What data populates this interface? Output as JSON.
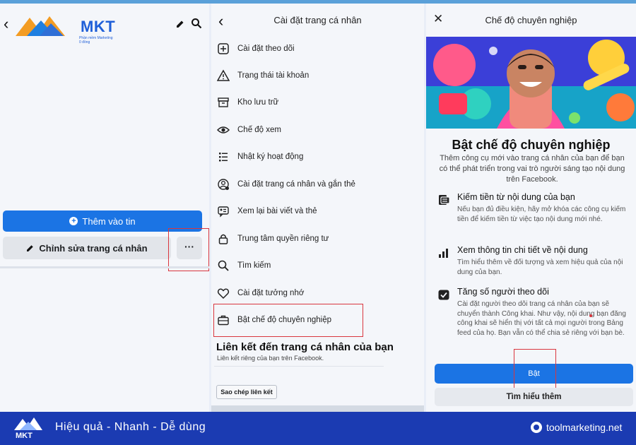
{
  "panel_left": {
    "logo": {
      "text": "MKT",
      "tagline": "Phần mềm Marketing 0 đồng"
    },
    "add_story_button": "Thêm vào tin",
    "edit_profile_button": "Chỉnh sửa trang cá nhân",
    "more_button": "···"
  },
  "panel_middle": {
    "title": "Cài đặt trang cá nhân",
    "menu": [
      {
        "label": "Cài đặt theo dõi",
        "icon": "follow-settings-icon"
      },
      {
        "label": "Trạng thái tài khoản",
        "icon": "warning-icon"
      },
      {
        "label": "Kho lưu trữ",
        "icon": "archive-icon"
      },
      {
        "label": "Chế độ xem",
        "icon": "eye-icon"
      },
      {
        "label": "Nhật ký hoạt động",
        "icon": "activity-log-icon"
      },
      {
        "label": "Cài đặt trang cá nhân và gắn thẻ",
        "icon": "profile-tag-icon"
      },
      {
        "label": "Xem lại bài viết và thẻ",
        "icon": "review-posts-icon"
      },
      {
        "label": "Trung tâm quyền riêng tư",
        "icon": "lock-icon"
      },
      {
        "label": "Tìm kiếm",
        "icon": "search-icon"
      },
      {
        "label": "Cài đặt tưởng nhớ",
        "icon": "heart-icon"
      },
      {
        "label": "Bật chế độ chuyên nghiệp",
        "icon": "briefcase-icon"
      }
    ],
    "link_section": {
      "title": "Liên kết đến trang cá nhân của bạn",
      "subtitle": "Liên kết riêng của bạn trên Facebook.",
      "copy_button": "Sao chép liên kết"
    }
  },
  "panel_right": {
    "title": "Chế độ chuyên nghiệp",
    "heading": "Bật chế độ chuyên nghiệp",
    "description": "Thêm công cụ mới vào trang cá nhân của bạn để bạn có thể phát triển trong vai trò người sáng tạo nội dung trên Facebook.",
    "features": [
      {
        "title": "Kiếm tiền từ nội dung của bạn",
        "desc": "Nếu bạn đủ điều kiện, hãy mở khóa các công cụ kiếm tiền để kiếm tiền từ việc tạo nội dung mới nhé.",
        "icon": "money-icon"
      },
      {
        "title": "Xem thông tin chi tiết về nội dung",
        "desc": "Tìm hiểu thêm về đối tượng và xem hiệu quả của nội dung của bạn.",
        "icon": "bar-chart-icon"
      },
      {
        "title": "Tăng số người theo dõi",
        "desc": "Cài đặt người theo dõi trang cá nhân của bạn sẽ chuyển thành Công khai. Như vậy, nội dung bạn đăng công khai sẽ hiển thị với tất cả mọi người trong Bảng feed của họ. Bạn vẫn có thể chia sẻ riêng với bạn bè.",
        "icon": "followers-icon"
      }
    ],
    "on_button": "Bật",
    "learn_more_button": "Tìm hiểu thêm"
  },
  "footer": {
    "logo_text": "MKT",
    "slogan": "Hiệu quả - Nhanh  - Dễ dùng",
    "site": "toolmarketing.net"
  },
  "colors": {
    "facebook_blue": "#1b74e4",
    "footer_blue": "#1b3bb2",
    "highlight_red": "#d9363e"
  }
}
